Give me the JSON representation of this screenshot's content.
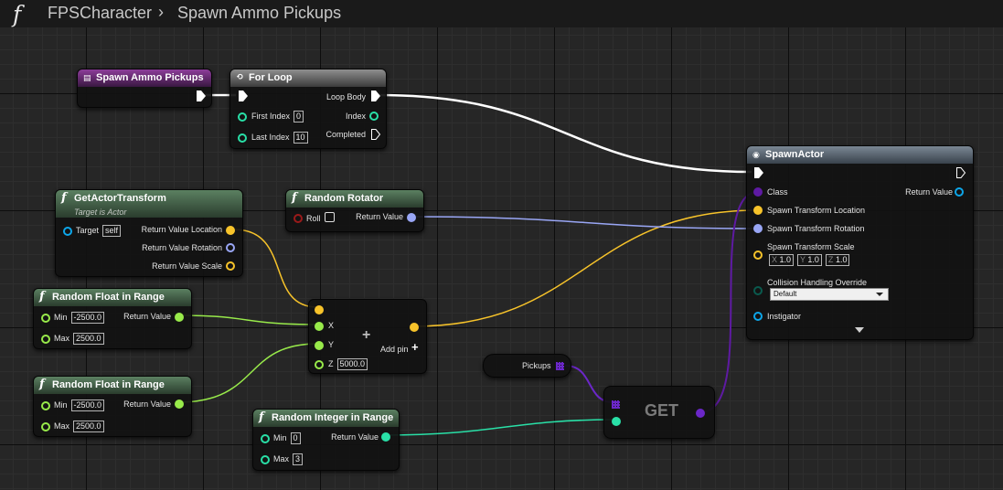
{
  "header": {
    "title": "FPSCharacter",
    "subtitle": "Spawn Ammo Pickups",
    "icon": "function-icon"
  },
  "colors": {
    "exec": "#ffffff",
    "float": "#98ea4a",
    "integer": "#29e0a7",
    "vector": "#f7c32a",
    "rotator": "#99a6f5",
    "object": "#6b27c8",
    "class": "#5e1aa2",
    "struct": "#0da6e9"
  },
  "nodes": {
    "event": {
      "title": "Spawn Ammo Pickups"
    },
    "forloop": {
      "title": "For Loop",
      "first_index_label": "First Index",
      "first_index": "0",
      "last_index_label": "Last Index",
      "last_index": "10",
      "loop_body": "Loop Body",
      "index": "Index",
      "completed": "Completed"
    },
    "gettransform": {
      "title": "GetActorTransform",
      "subtitle": "Target is Actor",
      "target_label": "Target",
      "target_value": "self",
      "ret_loc": "Return Value Location",
      "ret_rot": "Return Value Rotation",
      "ret_scale": "Return Value Scale"
    },
    "rotator": {
      "title": "Random Rotator",
      "roll": "Roll",
      "ret": "Return Value"
    },
    "rf1": {
      "title": "Random Float in Range",
      "min_label": "Min",
      "min": "-2500.0",
      "max_label": "Max",
      "max": "2500.0",
      "ret": "Return Value"
    },
    "rf2": {
      "title": "Random Float in Range",
      "min_label": "Min",
      "min": "-2500.0",
      "max_label": "Max",
      "max": "2500.0",
      "ret": "Return Value"
    },
    "makevec": {
      "x": "X",
      "y": "Y",
      "z": "Z",
      "z_value": "5000.0",
      "add_pin": "Add pin"
    },
    "randint": {
      "title": "Random Integer in Range",
      "min_label": "Min",
      "min": "0",
      "max_label": "Max",
      "max": "3",
      "ret": "Return Value"
    },
    "pickups": {
      "label": "Pickups"
    },
    "get": {
      "label": "GET"
    },
    "spawn": {
      "title": "SpawnActor",
      "class": "Class",
      "ret": "Return Value",
      "loc": "Spawn Transform Location",
      "rot": "Spawn Transform Rotation",
      "scale": "Spawn Transform Scale",
      "sx_label": "X",
      "sx": "1.0",
      "sy_label": "Y",
      "sy": "1.0",
      "sz_label": "Z",
      "sz": "1.0",
      "collision": "Collision Handling Override",
      "collision_value": "Default",
      "instigator": "Instigator"
    }
  }
}
